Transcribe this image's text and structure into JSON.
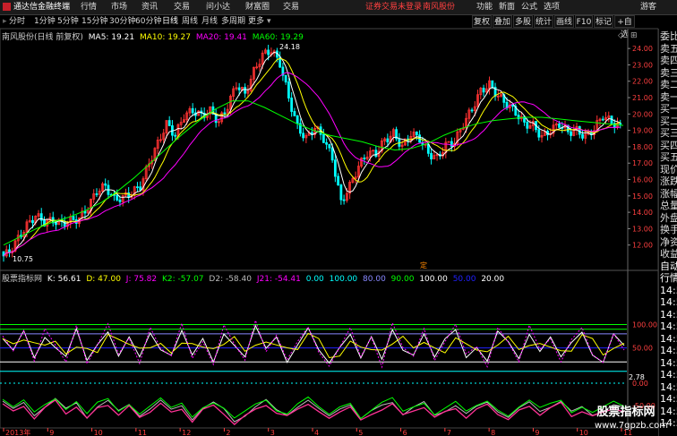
{
  "topbar": {
    "app_title": "通达信金融终端",
    "menu": [
      "行情",
      "市场",
      "资讯",
      "交易",
      "问小达",
      "财富圈",
      "交易"
    ],
    "notice": "证券交易未登录",
    "stock_name_top": "南风股份",
    "right_items": [
      "功能",
      "新面",
      "公式",
      "选项"
    ],
    "guest": "游客"
  },
  "periods": {
    "items": [
      "分时",
      "1分钟",
      "5分钟",
      "15分钟",
      "30分钟",
      "60分钟",
      "日线",
      "周线",
      "月线",
      "多周期",
      "更多"
    ],
    "active": "日线"
  },
  "toolbar": {
    "items": [
      "复权",
      "叠加",
      "多股",
      "统计",
      "画线",
      "F10",
      "标记",
      "+自选"
    ]
  },
  "main_chart": {
    "title": "南风股份(日线 前复权)",
    "ma": [
      {
        "label": "MA5: 19.21",
        "color": "#ffffff"
      },
      {
        "label": "MA10: 19.27",
        "color": "#ffff00"
      },
      {
        "label": "MA20: 19.41",
        "color": "#ff00ff"
      },
      {
        "label": "MA60: 19.29",
        "color": "#00ff00"
      }
    ],
    "high_label": "24.18",
    "low_label": "10.75",
    "marker_text": "定"
  },
  "indicator": {
    "name": "股票指标网",
    "values": [
      {
        "label": "K: 56.61",
        "color": "#ffffff"
      },
      {
        "label": "D: 47.00",
        "color": "#ffff00"
      },
      {
        "label": "J: 75.82",
        "color": "#ff00ff"
      },
      {
        "label": "K2: -57.07",
        "color": "#00ff00"
      },
      {
        "label": "D2: -58.40",
        "color": "#bbbbbb"
      },
      {
        "label": "J21: -54.41",
        "color": "#ff00ff"
      },
      {
        "label": "0.00",
        "color": "#00ffff"
      },
      {
        "label": "100.00",
        "color": "#00ffff"
      },
      {
        "label": "80.00",
        "color": "#8888ff"
      },
      {
        "label": "90.00",
        "color": "#00ff00"
      },
      {
        "label": "100.00",
        "color": "#ffffff"
      },
      {
        "label": "50.00",
        "color": "#2020ff"
      },
      {
        "label": "20.00",
        "color": "#ffffff"
      }
    ],
    "readout": "2.78"
  },
  "chart_data": [
    {
      "type": "candlestick",
      "title": "南风股份(日线 前复权)",
      "ylim": [
        11.0,
        24.5
      ],
      "y_ticks": [
        24.0,
        23.0,
        22.0,
        21.0,
        20.0,
        19.0,
        18.0,
        17.0,
        16.0,
        15.0,
        14.0,
        13.0,
        12.0
      ],
      "y_tick_labels": [
        "24.00",
        "23.00",
        "22.00",
        "21.00",
        "20.00",
        "19.00",
        "18.00",
        "17.00",
        "16.00",
        "15.00",
        "14.00",
        "13.00",
        "12.00"
      ],
      "close_path": [
        11.6,
        12.4,
        13.2,
        13.8,
        13.4,
        13.5,
        13.3,
        13.5,
        13.6,
        14.3,
        15.3,
        15.6,
        14.8,
        14.9,
        15.2,
        15.6,
        17.0,
        18.2,
        19.4,
        18.7,
        19.9,
        20.2,
        19.9,
        20.2,
        19.5,
        20.5,
        21.8,
        21.2,
        22.6,
        23.6,
        23.9,
        23.1,
        21.0,
        19.2,
        18.5,
        19.2,
        18.5,
        17.3,
        14.6,
        15.6,
        16.8,
        17.6,
        17.6,
        18.4,
        18.8,
        18.0,
        18.8,
        18.5,
        17.6,
        17.3,
        18.1,
        18.3,
        19.4,
        20.3,
        21.4,
        21.8,
        21.1,
        20.6,
        20.1,
        19.4,
        19.3,
        18.6,
        19.0,
        19.4,
        18.9,
        19.0,
        18.6,
        19.1,
        19.9,
        19.5,
        19.2
      ],
      "ma60_path": [
        12.0,
        12.5,
        13.0,
        13.4,
        13.7,
        14.1,
        14.6,
        15.3,
        16.1,
        17.0,
        17.9,
        18.8,
        19.6,
        20.3,
        20.8,
        20.8,
        20.4,
        19.9,
        19.4,
        19.0,
        18.7,
        18.5,
        18.3,
        18.0,
        17.8,
        17.9,
        18.2,
        18.7,
        19.1,
        19.4,
        19.6,
        19.7,
        19.8,
        19.8,
        19.7,
        19.6,
        19.5,
        19.4,
        19.3
      ],
      "series": [
        {
          "name": "MA5",
          "value": 19.21
        },
        {
          "name": "MA10",
          "value": 19.27
        },
        {
          "name": "MA20",
          "value": 19.41
        },
        {
          "name": "MA60",
          "value": 19.29
        }
      ],
      "annotations": [
        "24.18",
        "10.75"
      ]
    },
    {
      "type": "line",
      "title": "股票指标网",
      "upper_ylim": [
        -10,
        120
      ],
      "upper_ticks": [
        100.0,
        50.0
      ],
      "upper_tick_labels": [
        "100.00",
        "50.00"
      ],
      "lower_ylim": [
        -100,
        0
      ],
      "lower_ticks": [
        0.0,
        -50.0
      ],
      "lower_tick_labels": [
        "0.00",
        "-50.00"
      ],
      "reference_lines": [
        100,
        90,
        80,
        50,
        20,
        0
      ],
      "series": [
        {
          "name": "K",
          "value": 56.61
        },
        {
          "name": "D",
          "value": 47.0
        },
        {
          "name": "J",
          "value": 75.82
        },
        {
          "name": "K2",
          "value": -57.07
        },
        {
          "name": "D2",
          "value": -58.4
        },
        {
          "name": "J21",
          "value": -54.41
        }
      ],
      "k_path": [
        70,
        40,
        82,
        30,
        78,
        55,
        30,
        85,
        20,
        60,
        90,
        35,
        70,
        25,
        80,
        50,
        40,
        88,
        30,
        65,
        20,
        85,
        60,
        30,
        92,
        45,
        75,
        25,
        60,
        90,
        40,
        15,
        55,
        85,
        30,
        70,
        20,
        88,
        50,
        40,
        80,
        25,
        65,
        90,
        35,
        55,
        20,
        80,
        60,
        30,
        85,
        45,
        70,
        25,
        60,
        88,
        40,
        20,
        75,
        50
      ],
      "k2_path": [
        -40,
        -60,
        -45,
        -70,
        -50,
        -35,
        -60,
        -45,
        -75,
        -50,
        -40,
        -65,
        -48,
        -70,
        -55,
        -40,
        -62,
        -50,
        -78,
        -55,
        -45,
        -60,
        -85,
        -70,
        -52,
        -40,
        -62,
        -70,
        -50,
        -38,
        -60,
        -75,
        -55,
        -45,
        -80,
        -65,
        -50,
        -40,
        -68,
        -55,
        -45,
        -72,
        -60,
        -48,
        -70,
        -55,
        -42,
        -60,
        -75,
        -58,
        -45,
        -62,
        -50,
        -40,
        -66,
        -55,
        -70,
        -60,
        -48,
        -57
      ]
    }
  ],
  "x_axis": {
    "labels": [
      "2013年",
      "9",
      "10",
      "11",
      "12",
      "2",
      "3",
      "4",
      "5",
      "6",
      "7",
      "8",
      "9",
      "10",
      "11"
    ]
  },
  "right_panel": {
    "items": [
      "委比",
      "卖五",
      "卖四",
      "卖三",
      "卖二",
      "卖一",
      "买一",
      "买二",
      "买三",
      "买四",
      "买五",
      "现价",
      "涨跌",
      "涨幅",
      "总量",
      "外盘",
      "换手",
      "净资",
      "收益",
      "自动",
      "行情",
      "14:5",
      "14:5",
      "14:5",
      "14:5",
      "14:5",
      "14:5",
      "14:5",
      "14:5",
      "14:5",
      "14:5",
      "14:5",
      "14:5"
    ]
  },
  "watermark": {
    "line1": "股票指标网",
    "line2": "www.7gpzb.com"
  }
}
